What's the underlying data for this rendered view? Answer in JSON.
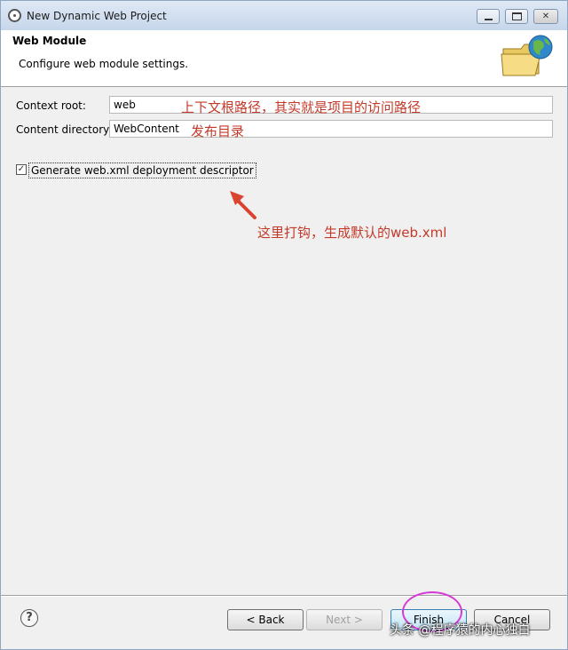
{
  "window": {
    "title": "New Dynamic Web Project"
  },
  "header": {
    "title": "Web Module",
    "description": "Configure web module settings."
  },
  "form": {
    "context_root": {
      "label": "Context root:",
      "value": "web"
    },
    "content_directory": {
      "label": "Content directory:",
      "value": "WebContent"
    },
    "generate_descriptor": {
      "label": "Generate web.xml deployment descriptor",
      "checked": true
    }
  },
  "annotations": {
    "context_root_note": "上下文根路径，其实就是项目的访问路径",
    "content_dir_note": "发布目录",
    "checkbox_note": "这里打钩，生成默认的web.xml"
  },
  "buttons": {
    "help": "?",
    "back": "< Back",
    "next": "Next >",
    "finish": "Finish",
    "cancel": "Cancel"
  },
  "watermark": "头条 @程序猿的内心独白",
  "colors": {
    "annotation_red": "#c43a2a",
    "highlight_magenta": "#d63bd6"
  },
  "icons": {
    "app": "eclipse-icon",
    "banner": "folder-globe-icon",
    "help": "help-icon"
  }
}
